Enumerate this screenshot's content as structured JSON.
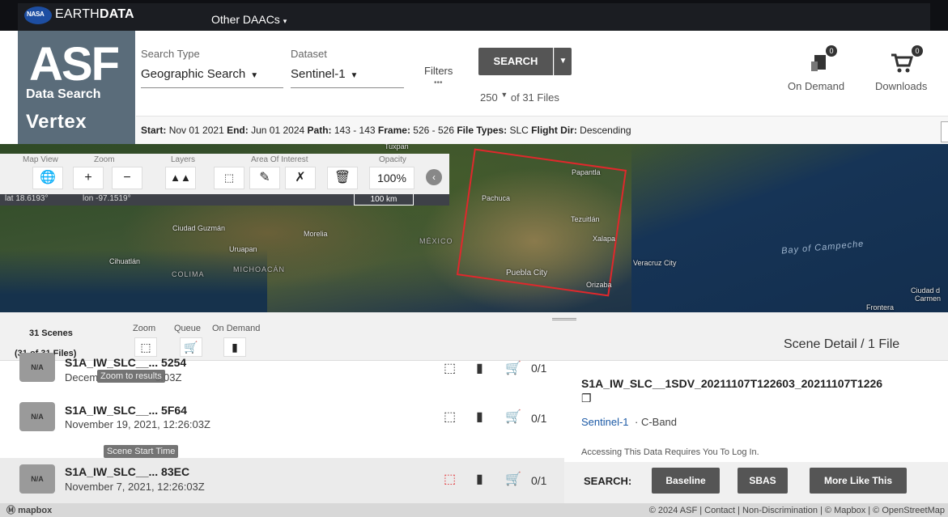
{
  "topbar": {
    "nasa_logo_text": "NASA",
    "earthdata_prefix": "EARTH",
    "earthdata_bold": "DATA",
    "daacs_label": "Other DAACs",
    "daacs_caret": "▾"
  },
  "logo": {
    "asf": "ASF",
    "data_search": "Data Search",
    "vertex": "Vertex"
  },
  "search": {
    "type_label": "Search Type",
    "type_value": "Geographic Search",
    "dataset_label": "Dataset",
    "dataset_value": "Sentinel-1",
    "filters_label": "Filters",
    "filters_dots": "•••",
    "search_button": "SEARCH",
    "max_results": "250",
    "files_suffix": "of 31 Files"
  },
  "header_right": {
    "on_demand_label": "On Demand",
    "on_demand_count": "0",
    "downloads_label": "Downloads",
    "downloads_count": "0"
  },
  "params": {
    "start_label": "Start:",
    "start_value": "Nov 01 2021",
    "end_label": "End:",
    "end_value": "Jun 01 2024",
    "path_label": "Path:",
    "path_value": "143 - 143",
    "frame_label": "Frame:",
    "frame_value": "526 - 526",
    "filetypes_label": "File Types:",
    "filetypes_value": "SLC",
    "flightdir_label": "Flight Dir:",
    "flightdir_value": "Descending"
  },
  "map_tools": {
    "map_view_label": "Map View",
    "zoom_label": "Zoom",
    "layers_label": "Layers",
    "aoi_label": "Area Of Interest",
    "opacity_label": "Opacity",
    "opacity_value": "100%",
    "lat": "lat 18.6193°",
    "lon": "lon -97.1519°",
    "scale": "100 km"
  },
  "map_places": {
    "pachuca": "Pachuca",
    "tuxpan": "Tuxpan",
    "papantla": "Papantla",
    "tezuitlan": "Tezuitlán",
    "xalapa": "Xalapa",
    "puebla": "Puebla City",
    "orizaba": "Orizaba",
    "veracruz": "Veracruz City",
    "ciudad_guzman": "Ciudad Guzmán",
    "morelia": "Morelia",
    "uruapan": "Uruapan",
    "michoacan": "MICHOACÁN",
    "colima": "COLIMA",
    "cihuatlan": "Cihuatlán",
    "mexico": "MÉXICO",
    "bay": "Bay of Campeche",
    "ciudad_right": "Ciudad d",
    "carmen": "Carmen",
    "frontera": "Frontera"
  },
  "results": {
    "scenes_count": "31 Scenes",
    "scenes_files": "(31 of 31 Files)",
    "zoom_label": "Zoom",
    "queue_label": "Queue",
    "on_demand_label": "On Demand",
    "detail_header": "Scene Detail / 1 File",
    "rows": [
      {
        "badge": "N/A",
        "title": "S1A_IW_SLC__... 5254",
        "date_prefix": "Decem",
        "date_suffix": "6:03Z",
        "count": "0/1"
      },
      {
        "badge": "N/A",
        "title": "S1A_IW_SLC__... 5F64",
        "date": "November 19, 2021, 12:26:03Z",
        "count": "0/1"
      },
      {
        "badge": "N/A",
        "title": "S1A_IW_SLC__... 83EC",
        "date": "November 7, 2021, 12:26:03Z",
        "count": "0/1"
      }
    ],
    "tooltip_zoom": "Zoom to results",
    "tooltip_start": "Scene Start Time"
  },
  "detail": {
    "title": "S1A_IW_SLC__1SDV_20211107T122603_20211107T1226",
    "dataset": "Sentinel-1",
    "band": "· C-Band",
    "login_note": "Accessing This Data Requires You To Log In.",
    "search_label": "SEARCH:",
    "baseline": "Baseline",
    "sbas": "SBAS",
    "more_like_this": "More Like This"
  },
  "footer": {
    "mapbox": "mapbox",
    "text": "© 2024 ASF | Contact | Non-Discrimination | © Mapbox | © OpenStreetMap"
  },
  "colors": {
    "aoi_outline": "#e0282c",
    "button_bg": "#555555",
    "dataset_link": "#1c5aa6"
  }
}
